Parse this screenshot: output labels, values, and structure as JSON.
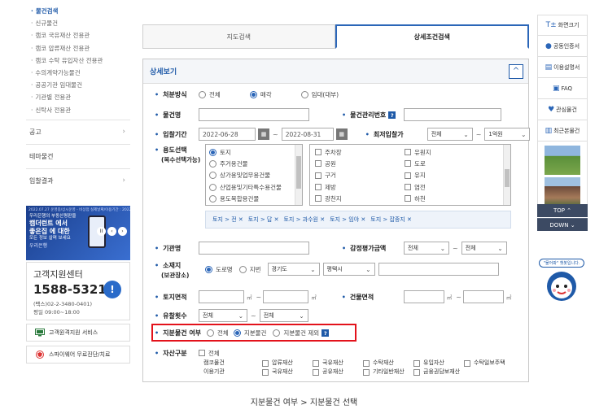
{
  "sidebar": {
    "sub_items": [
      {
        "label": "물건검색",
        "active": true
      },
      {
        "label": "신규물건"
      },
      {
        "label": "캠코 국유재산 전용관"
      },
      {
        "label": "캠코 압류재산 전용관"
      },
      {
        "label": "캠코 수탁 유입자산 전용관"
      },
      {
        "label": "수의계약가능물건"
      },
      {
        "label": "공공기관 임대물건"
      },
      {
        "label": "기관별 전용관"
      },
      {
        "label": "신탁사 전용관"
      }
    ],
    "menu": [
      {
        "label": "공고",
        "chevron": "›"
      },
      {
        "label": "테마물건",
        "chevron": ""
      },
      {
        "label": "입찰결과",
        "chevron": "›"
      }
    ],
    "banner": {
      "period": "2022.07.27 운영중/상시운영 - 비상점 실제날짜/이용기간 : 2022.12.31",
      "line1": "우리은행의 부동산평판을",
      "line2": "캠더런트 에서",
      "line3": "좋은집 에 대한",
      "line4": "모든 정보 살펴 보세요",
      "brand": "우리은행",
      "pause": "II",
      "prev": "‹",
      "next": "›"
    },
    "cs": {
      "title": "고객지원센터",
      "number": "1588-5321",
      "fax": "(팩스)02-2-3480-0401)",
      "hours": "평일 09:00~18:00",
      "icon": "!"
    },
    "service1": "고객원격지원 서비스",
    "service2": "스파이웨어 무료진단/치료"
  },
  "tabs": [
    {
      "label": "지도검색",
      "active": false
    },
    {
      "label": "상세조건검색",
      "active": true
    }
  ],
  "panel": {
    "title": "상세보기",
    "collapse": "^"
  },
  "form": {
    "disposal": {
      "label": "처분방식",
      "options": [
        "전체",
        "매각",
        "임대(대부)"
      ],
      "selected": 1
    },
    "name": {
      "label": "물건명"
    },
    "mgmt_no": {
      "label": "물건관리번호",
      "help": "?"
    },
    "period": {
      "label": "입찰기간",
      "from": "2022-06-28",
      "to": "2022-08-31",
      "cal": "▦"
    },
    "min_price": {
      "label": "최저입찰가",
      "from": "전체",
      "to": "1억원"
    },
    "usage": {
      "label": "용도선택",
      "label2": "(복수선택가능)",
      "left_items": [
        "토지",
        "주거용건물",
        "상가용및업무용건물",
        "산업용및기타특수용건물",
        "용도복합용건물"
      ],
      "left_selected": 0,
      "right_items": [
        "주차장",
        "유원지",
        "공원",
        "도로",
        "구거",
        "유지",
        "제방",
        "염전",
        "광천지",
        "하천"
      ],
      "chips": [
        "토지 > 전 ✕",
        "토지 > 답 ✕",
        "토지 > 과수원 ✕",
        "토지 > 임야 ✕",
        "토지 > 잡종지 ✕"
      ]
    },
    "agency": {
      "label": "기관명"
    },
    "appraisal": {
      "label": "감정평가금액",
      "from": "전체",
      "to": "전체"
    },
    "location": {
      "label": "소재지",
      "label2": "(보관장소)",
      "options": [
        "도로명",
        "지번"
      ],
      "selected": 0,
      "sido": "경기도",
      "sigungu": "평택시"
    },
    "land_area": {
      "label": "토지면적",
      "unit": "㎡"
    },
    "bldg_area": {
      "label": "건물면적",
      "unit": "㎡"
    },
    "fail_count": {
      "label": "유찰횟수",
      "from": "전체",
      "to": "전체"
    },
    "share": {
      "label": "지분물건 여부",
      "options": [
        "전체",
        "지분물건",
        "지분물건 제외"
      ],
      "selected": 1,
      "help": "?"
    },
    "asset": {
      "label": "자산구분",
      "all": "전체",
      "group1": "캠코물건",
      "group2": "이용기관",
      "kamco_items": [
        "압류재산",
        "국유재산",
        "수탁재산",
        "유입자산",
        "수탁일보주택"
      ],
      "agency_items": [
        "국유재산",
        "공유재산",
        "기타일반재산",
        "금융권담보재산"
      ]
    }
  },
  "rail": {
    "items": [
      {
        "icon": "T±",
        "label": "화면크기"
      },
      {
        "icon": "●",
        "label": "공동인증서"
      },
      {
        "icon": "▤",
        "label": "이용설명서"
      },
      {
        "icon": "▣",
        "label": "FAQ"
      },
      {
        "icon": "♥",
        "label": "관심물건"
      },
      {
        "icon": "▥",
        "label": "최근본물건"
      }
    ],
    "top": "TOP ⌃",
    "down": "DOWN ⌄",
    "mascot": "\"물어봐\" 챗봇입니다."
  },
  "caption": "지분물건 여부 > 지분물건 선택"
}
